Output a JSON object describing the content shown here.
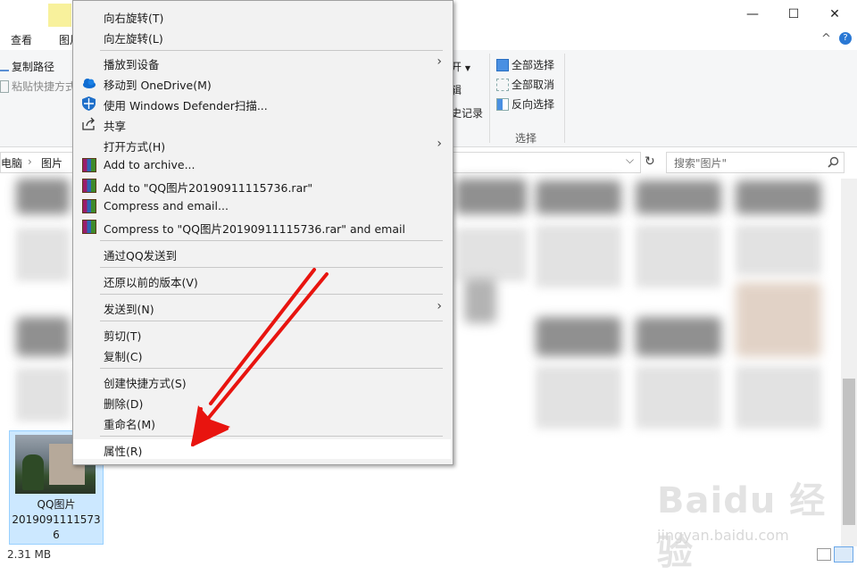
{
  "ribbon": {
    "tabs": [
      "查看",
      "图片"
    ],
    "clipboard": {
      "copy_path": "复制路径",
      "paste_shortcut": "粘贴快捷方式"
    },
    "partial_items": [
      "开",
      "辑",
      "史记录"
    ],
    "select": {
      "select_all": "全部选择",
      "select_none": "全部取消",
      "invert": "反向选择",
      "group_label": "选择"
    }
  },
  "window": {
    "minimize": "—",
    "maximize": "☐",
    "close": "✕",
    "help": "?",
    "collapse": "^"
  },
  "address": {
    "part1": "电脑",
    "sep": "›",
    "part2": "图片"
  },
  "search": {
    "placeholder": "搜索\"图片\""
  },
  "file": {
    "name_line1": "QQ图片",
    "name_line2": "2019091111573",
    "name_line3": "6"
  },
  "status": {
    "size": "2.31 MB"
  },
  "context_menu": {
    "items": [
      {
        "label": "向右旋转(T)"
      },
      {
        "label": "向左旋转(L)"
      },
      {
        "label": "播放到设备"
      },
      {
        "label": "移动到 OneDrive(M)"
      },
      {
        "label": "使用 Windows Defender扫描..."
      },
      {
        "label": "共享"
      },
      {
        "label": "打开方式(H)"
      },
      {
        "label": "Add to archive..."
      },
      {
        "label": "Add to \"QQ图片20190911115736.rar\""
      },
      {
        "label": "Compress and email..."
      },
      {
        "label": "Compress to \"QQ图片20190911115736.rar\" and email"
      },
      {
        "label": "通过QQ发送到"
      },
      {
        "label": "还原以前的版本(V)"
      },
      {
        "label": "发送到(N)"
      },
      {
        "label": "剪切(T)"
      },
      {
        "label": "复制(C)"
      },
      {
        "label": "创建快捷方式(S)"
      },
      {
        "label": "删除(D)"
      },
      {
        "label": "重命名(M)"
      },
      {
        "label": "属性(R)"
      }
    ]
  },
  "watermark": {
    "brand": "Baidu 经验",
    "url": "jingyan.baidu.com"
  },
  "colors": {
    "arrow": "#e8140f",
    "selection": "#cce8ff",
    "menu_bg": "#f2f2f2"
  }
}
